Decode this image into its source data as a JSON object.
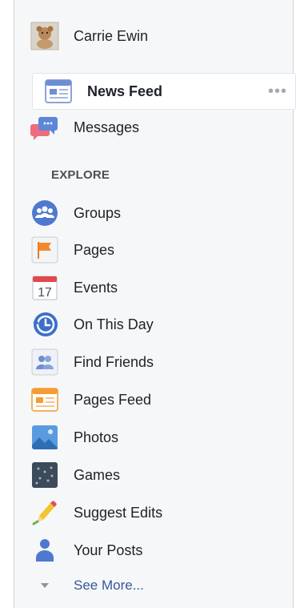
{
  "profile": {
    "name": "Carrie Ewin"
  },
  "nav": {
    "news_feed": "News Feed",
    "news_feed_more": "•••",
    "messages": "Messages"
  },
  "explore": {
    "heading": "EXPLORE",
    "items": [
      {
        "label": "Groups",
        "icon": "groups-icon"
      },
      {
        "label": "Pages",
        "icon": "pages-flag-icon"
      },
      {
        "label": "Events",
        "icon": "calendar-icon",
        "day": "17"
      },
      {
        "label": "On This Day",
        "icon": "on-this-day-clock-icon"
      },
      {
        "label": "Find Friends",
        "icon": "find-friends-icon"
      },
      {
        "label": "Pages Feed",
        "icon": "pages-feed-icon"
      },
      {
        "label": "Photos",
        "icon": "photos-icon"
      },
      {
        "label": "Games",
        "icon": "games-icon"
      },
      {
        "label": "Suggest Edits",
        "icon": "pencil-icon"
      },
      {
        "label": "Your Posts",
        "icon": "person-icon"
      }
    ],
    "see_more": "See More..."
  },
  "colors": {
    "facebook_blue": "#4267b2",
    "link_blue": "#365899",
    "text": "#1d2129",
    "panel_bg": "#f6f7f9"
  }
}
